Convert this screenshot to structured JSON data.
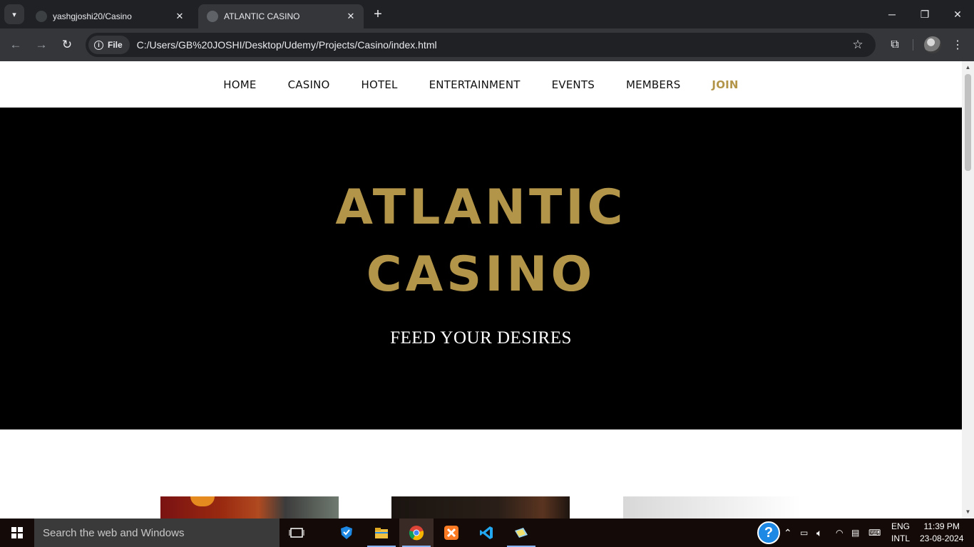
{
  "browser": {
    "tabs": [
      {
        "title": "yashgjoshi20/Casino",
        "active": false
      },
      {
        "title": "ATLANTIC CASINO",
        "active": true
      }
    ],
    "new_tab_symbol": "+",
    "site_chip_label": "File",
    "url": "C:/Users/GB%20JOSHI/Desktop/Udemy/Projects/Casino/index.html"
  },
  "site": {
    "nav": [
      "HOME",
      "CASINO",
      "HOTEL",
      "ENTERTAINMENT",
      "EVENTS",
      "MEMBERS",
      "JOIN"
    ],
    "hero": {
      "title_line1": "ATLANTIC",
      "title_line2": "CASINO",
      "tagline": "FEED YOUR DESIRES"
    },
    "accent_color": "#b3954a"
  },
  "taskbar": {
    "search_placeholder": "Search the web and Windows",
    "language_top": "ENG",
    "language_bottom": "INTL",
    "time": "11:39 PM",
    "date": "23-08-2024"
  }
}
